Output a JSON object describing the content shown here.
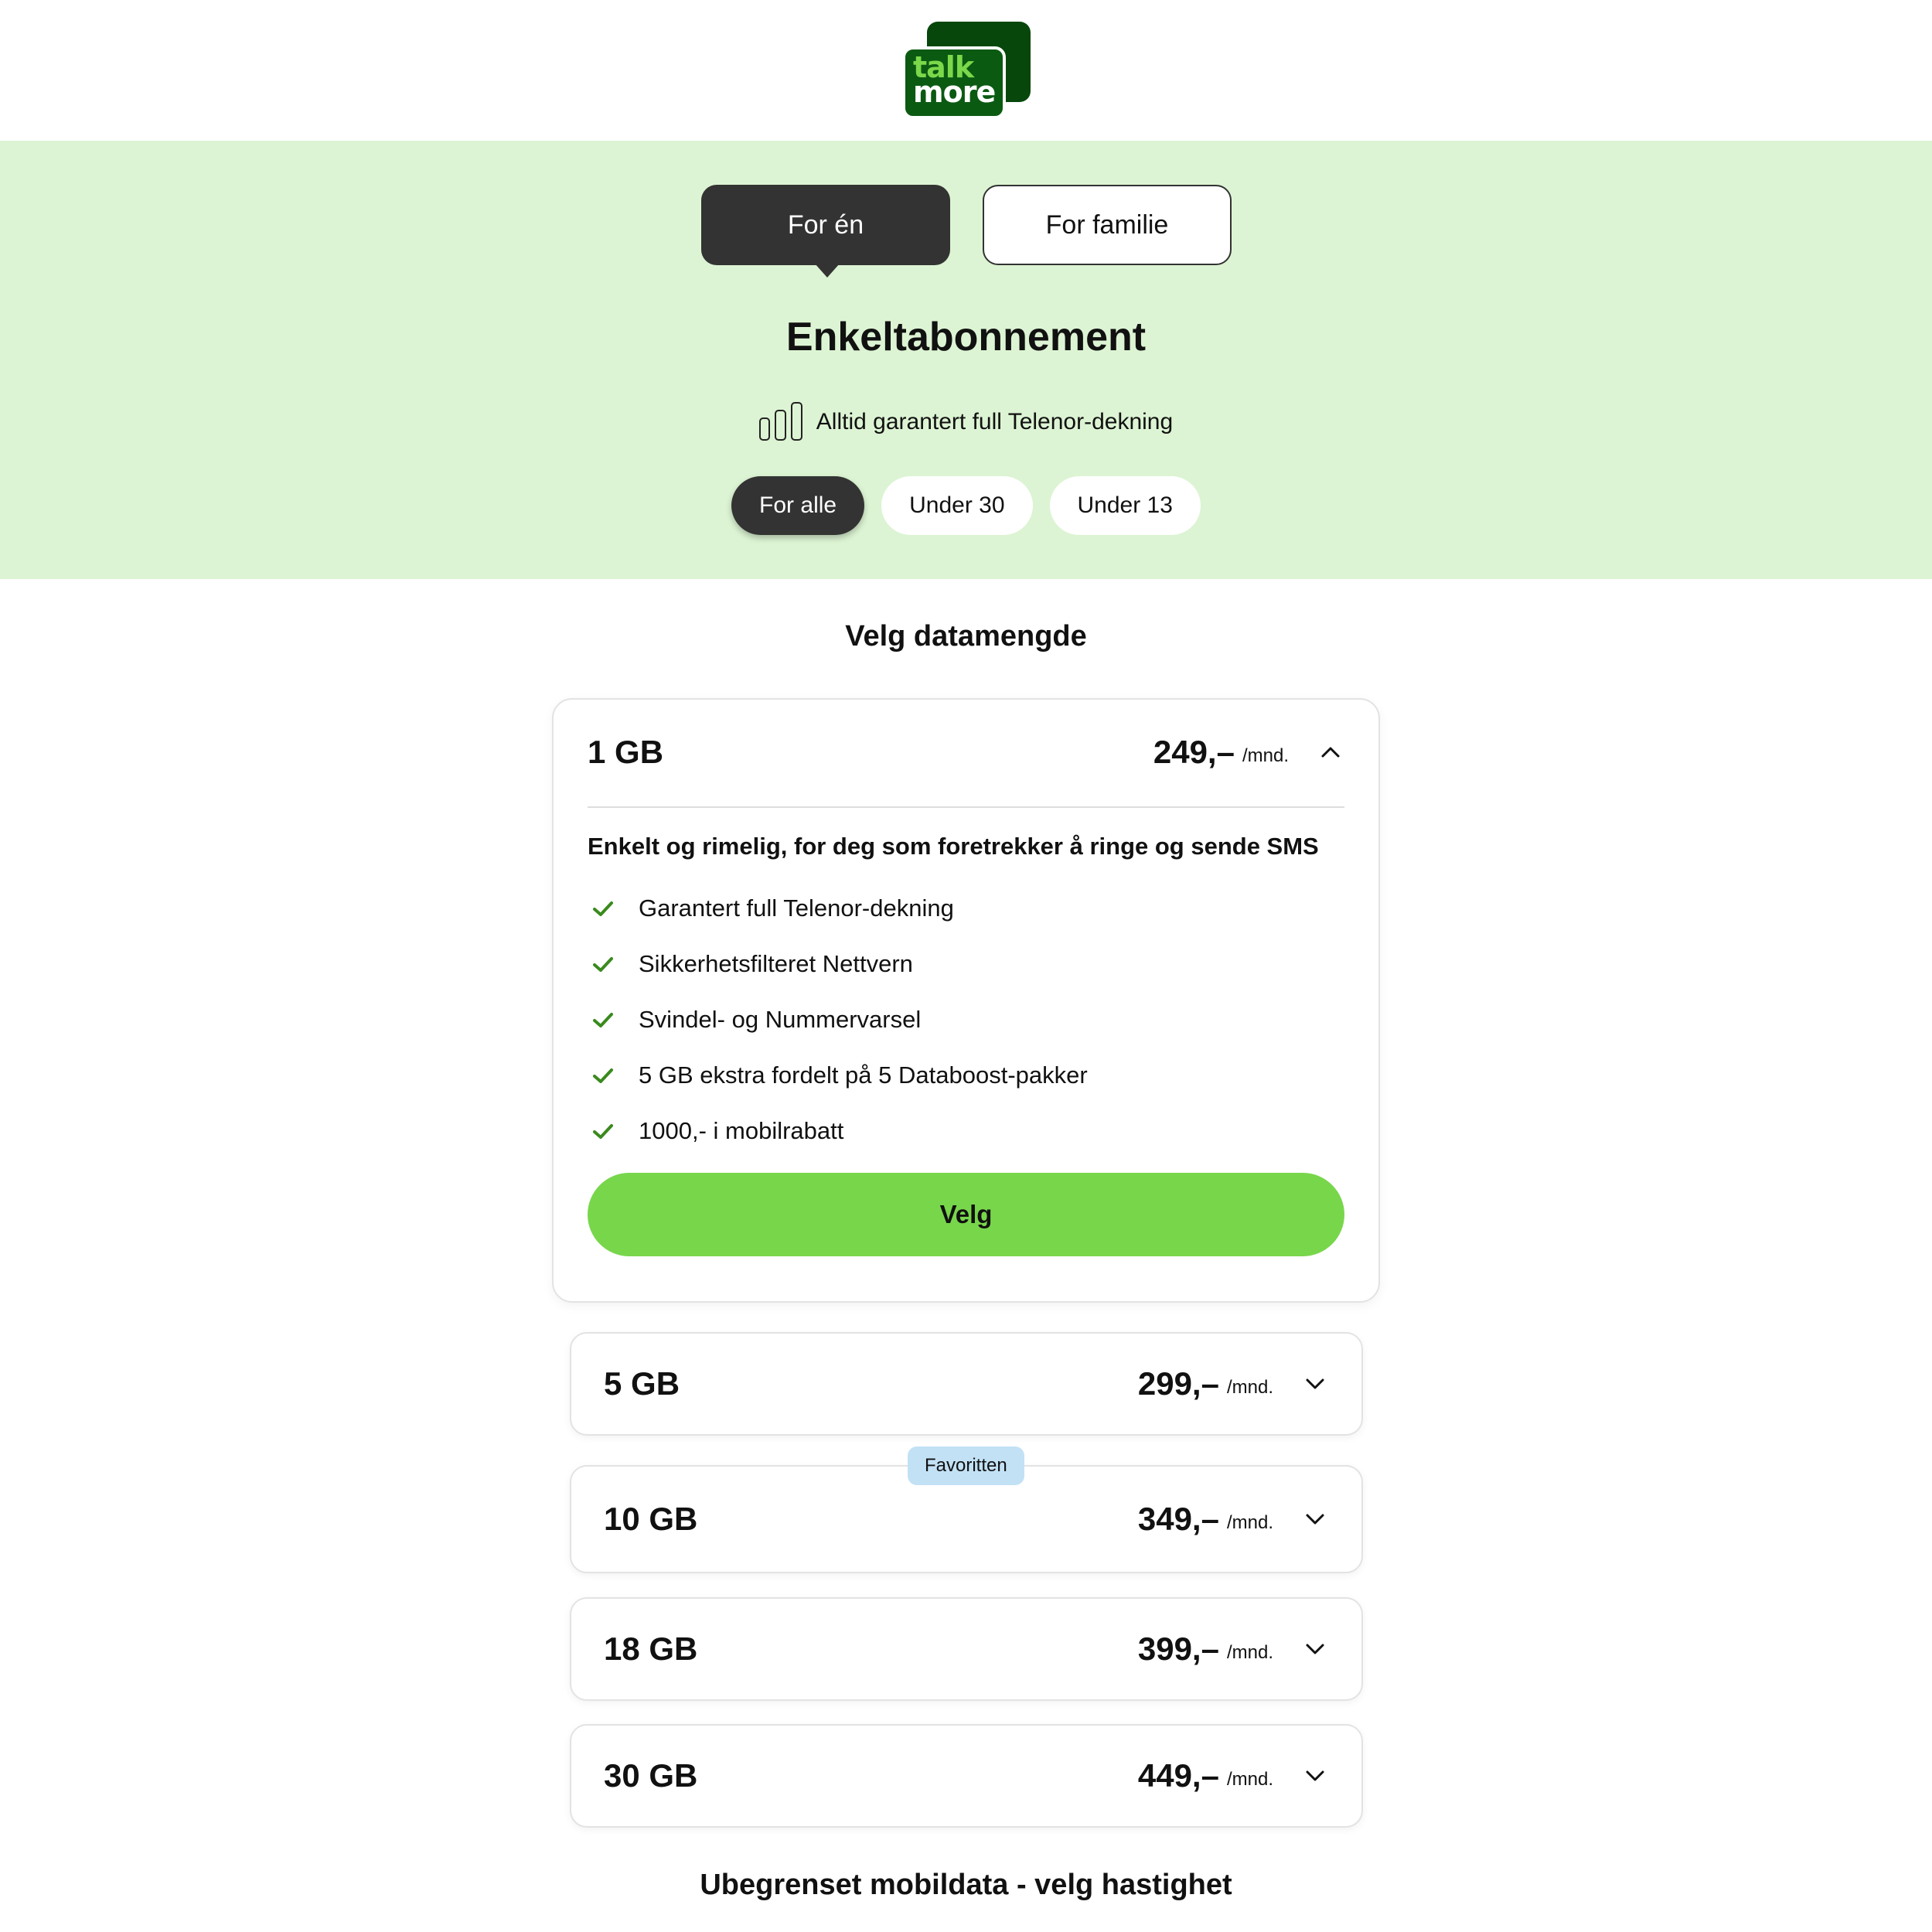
{
  "brand": {
    "logo_line1": "talk",
    "logo_line2": "more"
  },
  "segment": {
    "option_one": "For én",
    "option_family": "For familie"
  },
  "hero": {
    "title": "Enkeltabonnement",
    "coverage_text": "Alltid garantert full Telenor-dekning",
    "age_tabs": [
      "For alle",
      "Under 30",
      "Under 13"
    ]
  },
  "data_section": {
    "title": "Velg datamengde"
  },
  "expanded_plan": {
    "gb": "1 GB",
    "price": "249,–",
    "unit": "/mnd.",
    "description": "Enkelt og rimelig, for deg som foretrekker å ringe og sende SMS",
    "features": [
      "Garantert full Telenor-dekning",
      "Sikkerhetsfilteret Nettvern",
      "Svindel- og Nummervarsel",
      "5 GB ekstra fordelt på 5 Databoost-pakker",
      "1000,- i mobilrabatt"
    ],
    "button": "Velg"
  },
  "plans": [
    {
      "gb": "5 GB",
      "price": "299,–",
      "unit": "/mnd."
    },
    {
      "gb": "10 GB",
      "price": "349,–",
      "unit": "/mnd.",
      "badge": "Favoritten"
    },
    {
      "gb": "18 GB",
      "price": "399,–",
      "unit": "/mnd."
    },
    {
      "gb": "30 GB",
      "price": "449,–",
      "unit": "/mnd."
    }
  ],
  "unlimited_section": {
    "title": "Ubegrenset mobildata - velg hastighet"
  },
  "colors": {
    "hero_bg": "#dcf4d3",
    "accent_green": "#78d64b",
    "dark": "#333333",
    "badge_bg": "#c2e1f5",
    "check_green": "#3a8a1e"
  }
}
